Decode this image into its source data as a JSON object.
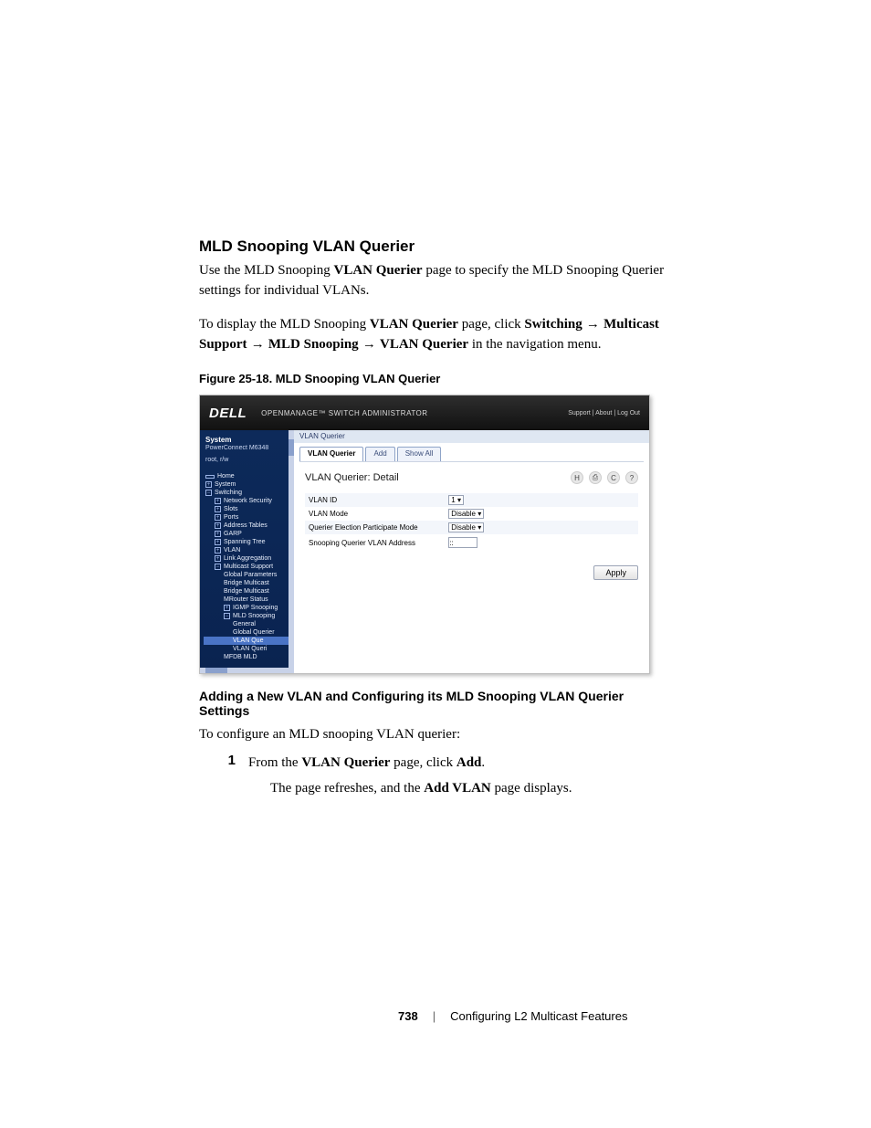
{
  "section_heading": "MLD Snooping VLAN Querier",
  "para1_a": "Use the MLD Snooping ",
  "para1_b": "VLAN Querier",
  "para1_c": " page to specify the MLD Snooping Querier settings for individual VLANs.",
  "para2_a": "To display the MLD Snooping ",
  "para2_b": "VLAN Querier",
  "para2_c": " page, click ",
  "para2_d": "Switching",
  "para2_e": "Multicast Support",
  "para2_f": "MLD Snooping",
  "para2_g": "VLAN Querier",
  "para2_h": " in the navigation menu.",
  "arrow": "→",
  "fig_caption": "Figure 25-18.    MLD Snooping VLAN Querier",
  "shot": {
    "logo": "DELL",
    "top_title": "OPENMANAGE™ SWITCH ADMINISTRATOR",
    "top_links": "Support  |  About  |  Log Out",
    "sys_head": "System",
    "sys_sub1": "PowerConnect M6348",
    "sys_sub2": "root, r/w",
    "tree": {
      "home": "Home",
      "system": "System",
      "switching": "Switching",
      "netsec": "Network Security",
      "slots": "Slots",
      "ports": "Ports",
      "addrtbl": "Address Tables",
      "garp": "GARP",
      "stp": "Spanning Tree",
      "vlan": "VLAN",
      "linkagg": "Link Aggregation",
      "mcast": "Multicast Support",
      "globparam": "Global Parameters",
      "bridgemc1": "Bridge Multicast",
      "bridgemc2": "Bridge Multicast",
      "mrouter": "MRouter Status",
      "igmp": "IGMP Snooping",
      "mld": "MLD Snooping",
      "general": "General",
      "globalq": "Global Querier",
      "vlanque": "VLAN Que",
      "vlanquer": "VLAN Queri",
      "mfdb": "MFDB MLD"
    },
    "crumb": "VLAN Querier",
    "tabs": [
      "VLAN Querier",
      "Add",
      "Show All"
    ],
    "detail_title": "VLAN Querier: Detail",
    "icons": {
      "save": "H",
      "print": "⎙",
      "refresh": "C",
      "help": "?"
    },
    "fields": {
      "vlanid_label": "VLAN ID",
      "vlanid_val": "1",
      "vlanmode_label": "VLAN Mode",
      "vlanmode_val": "Disable",
      "qep_label": "Querier Election Participate Mode",
      "qep_val": "Disable",
      "sqva_label": "Snooping Querier VLAN Address",
      "sqva_val": "::"
    },
    "apply": "Apply"
  },
  "subheading": "Adding a New VLAN and Configuring its MLD Snooping VLAN Querier Settings",
  "para3": "To configure an MLD snooping VLAN querier:",
  "step1_num": "1",
  "step1_a": "From the ",
  "step1_b": "VLAN Querier",
  "step1_c": " page, click ",
  "step1_d": "Add",
  "step1_e": ".",
  "step1_cont_a": "The page refreshes, and the ",
  "step1_cont_b": "Add VLAN",
  "step1_cont_c": " page displays.",
  "footer_page": "738",
  "footer_sep": "|",
  "footer_title": "Configuring L2 Multicast Features"
}
